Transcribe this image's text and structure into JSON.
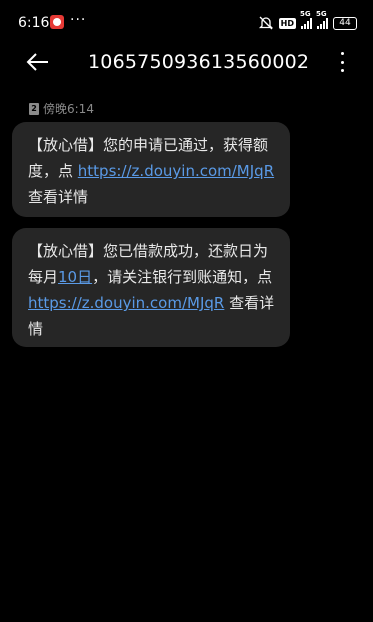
{
  "status_bar": {
    "time": "6:16",
    "more": "···",
    "hd": "HD",
    "net1": "5G",
    "net2": "5G",
    "battery": "44"
  },
  "header": {
    "title": "106575093613560002"
  },
  "sim": {
    "number": "2",
    "timestamp": "傍晚6:14"
  },
  "messages": [
    {
      "text_before": "【放心借】您的申请已通过，获得额度，点 ",
      "link": "https://z.douyin.com/MJqR",
      "text_after": " 查看详情"
    },
    {
      "text_before": "【放心借】您已借款成功，还款日为每月",
      "date_link": "10日",
      "text_middle": "，请关注银行到账通知，点 ",
      "link": "https://z.douyin.com/MJqR",
      "text_after": " 查看详情"
    }
  ],
  "colors": {
    "background": "#000000",
    "bubble": "#262626",
    "link": "#5a9ae6",
    "muted": "#8a8a8a"
  }
}
